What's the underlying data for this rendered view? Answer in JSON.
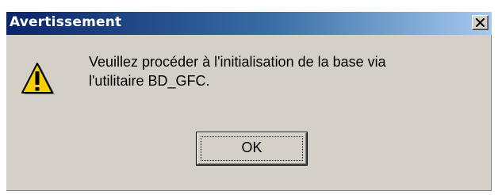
{
  "window": {
    "title": "Avertissement"
  },
  "message": {
    "line1": "Veuillez procéder à l'initialisation de la base via",
    "line2": "l'utilitaire BD_GFC."
  },
  "buttons": {
    "ok_label": "OK",
    "close_icon": "close-icon"
  },
  "icons": {
    "warning": "warning-icon"
  },
  "colors": {
    "titlebar_start": "#0a246a",
    "titlebar_end": "#a6caf0",
    "dialog_background": "#d4d0c8",
    "warning_fill": "#f5d000"
  }
}
